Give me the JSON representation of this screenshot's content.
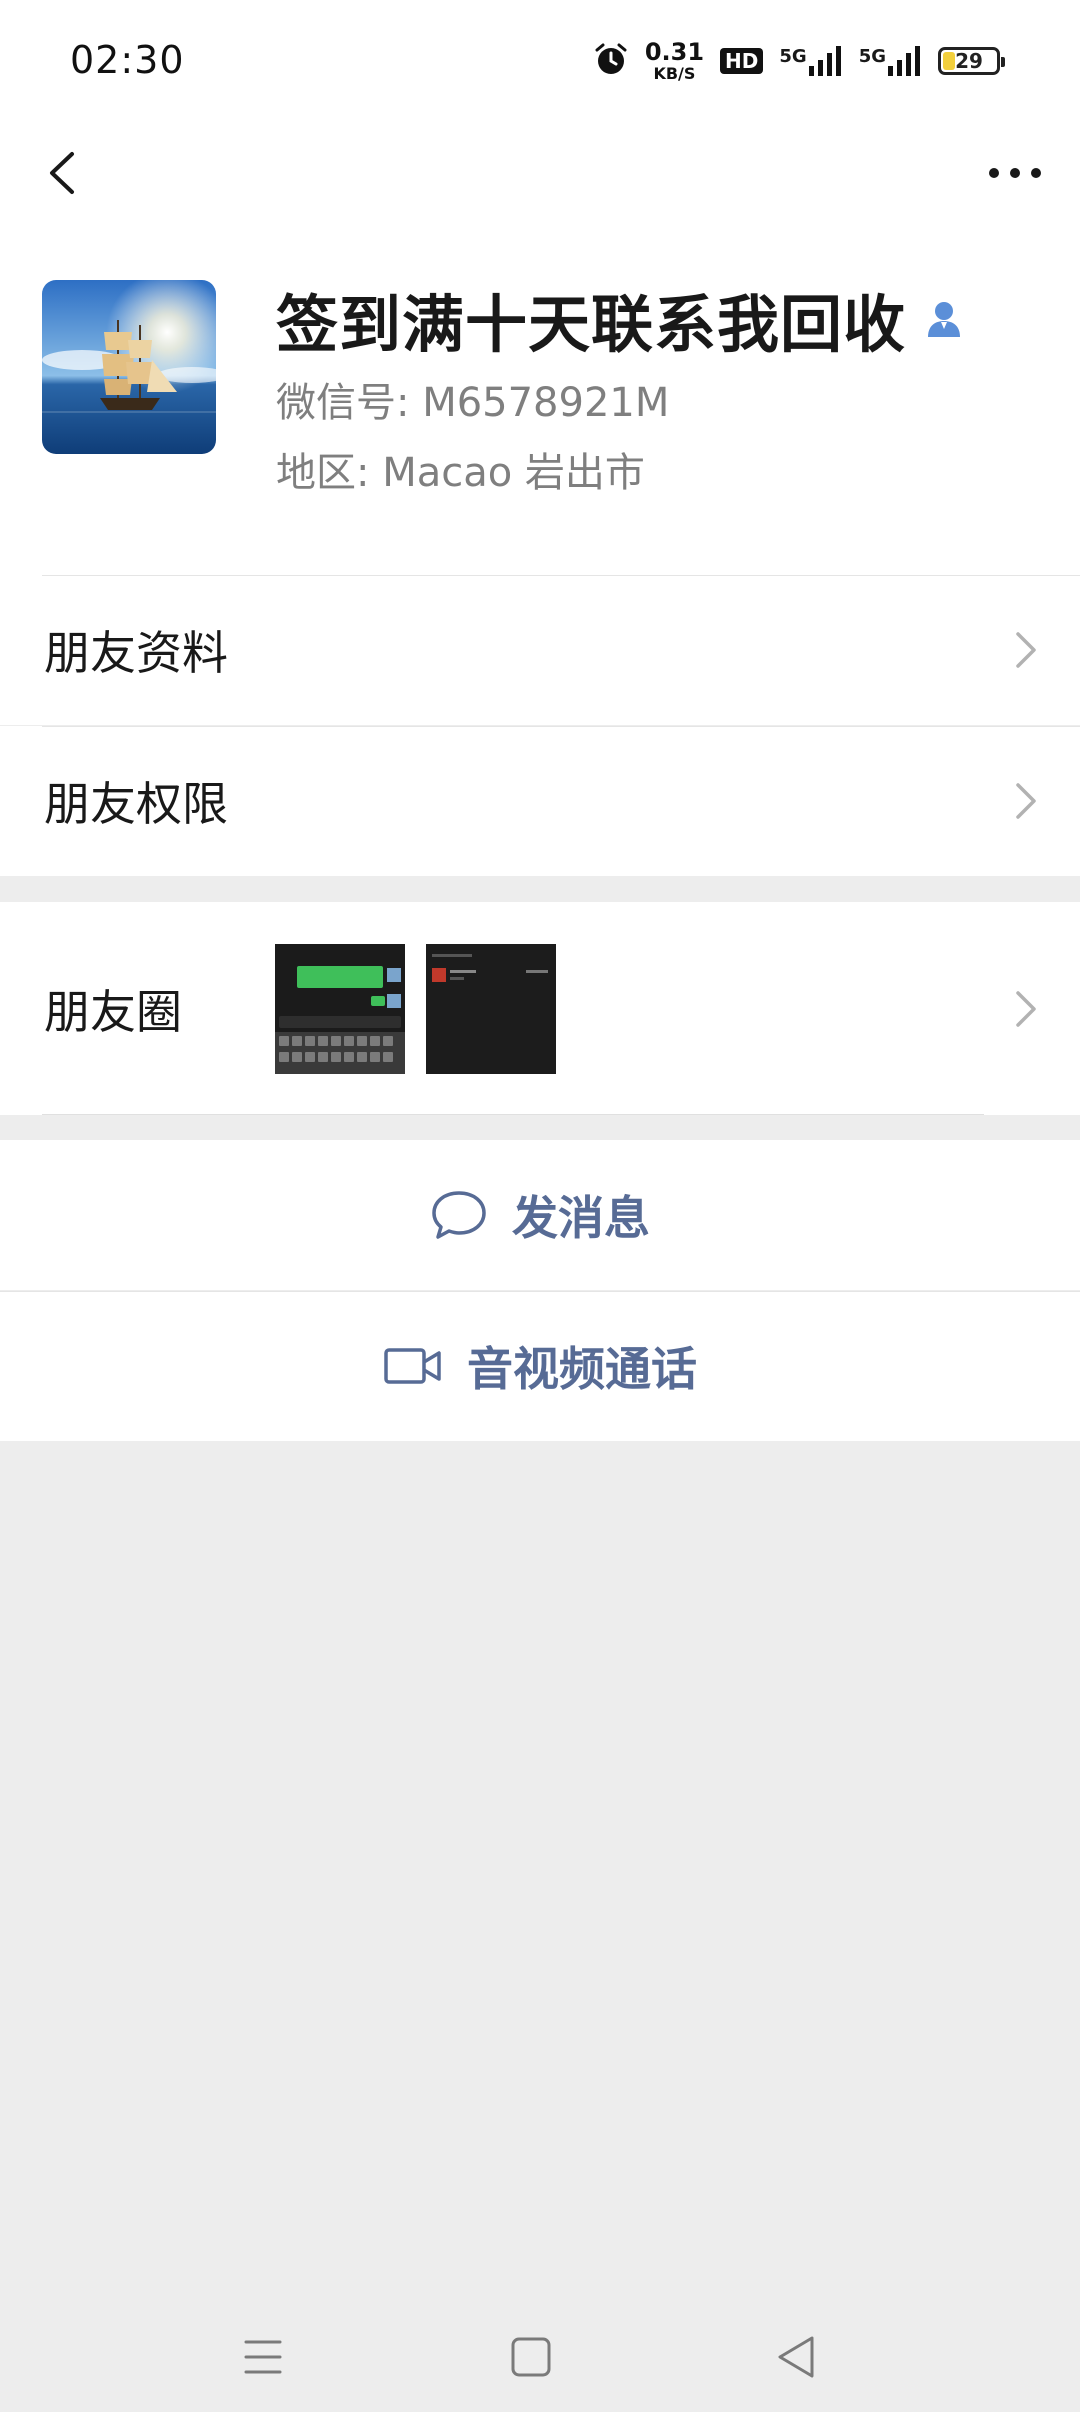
{
  "status_bar": {
    "time": "02:30",
    "net_speed_value": "0.31",
    "net_speed_unit": "KB/S",
    "hd_badge": "HD",
    "signal_1_label": "5G",
    "signal_2_label": "5G",
    "battery_level": "29",
    "battery_fraction": 0.29,
    "battery_color": "#f2cf3c"
  },
  "header": {
    "back_icon": "chevron-left-icon",
    "more_icon": "more-dots-icon"
  },
  "profile": {
    "nickname": "签到满十天联系我回收",
    "wechat_id": "微信号:  M6578921M",
    "region": "地区:  Macao  岩出市",
    "contact_icon": "person-icon",
    "accent_color": "#5b8fd8"
  },
  "rows": {
    "friend_info": "朋友资料",
    "friend_permissions": "朋友权限",
    "moments": "朋友圈"
  },
  "actions": {
    "send_message": "发消息",
    "av_call": "音视频通话",
    "link_color": "#576b95"
  },
  "system_nav": {
    "menu_icon": "menu-icon",
    "home_icon": "home-icon",
    "back_icon": "back-triangle-icon"
  }
}
